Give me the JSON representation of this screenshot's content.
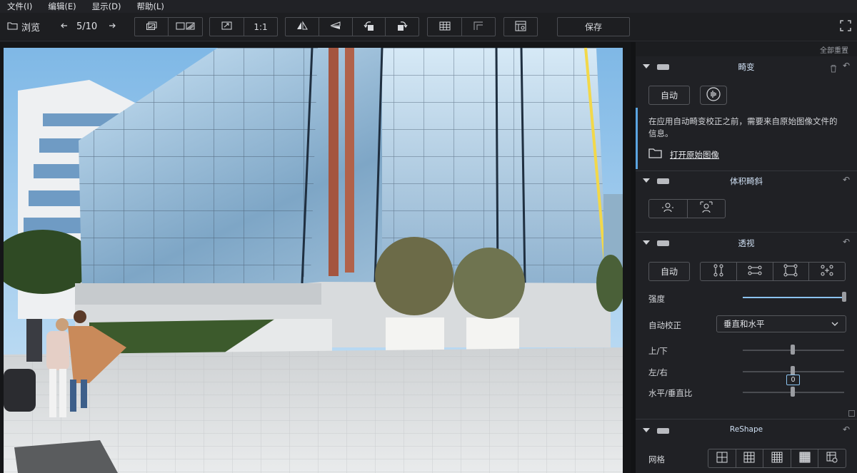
{
  "menu": [
    "文件(I)",
    "编辑(E)",
    "显示(D)",
    "帮助(L)"
  ],
  "toolbar": {
    "browse_label": "浏览",
    "page_counter": "5/10",
    "zoom_1to1": "1:1",
    "save_label": "保存"
  },
  "panel": {
    "top_label": "全部重置",
    "distortion": {
      "title": "畸变",
      "auto_label": "自动",
      "info_text_1": "在应用自动畸变校正之前，需要来自原始图像文件的",
      "info_text_2": "信息。",
      "open_raw_link": "打开原始图像"
    },
    "volume": {
      "title": "体积畸斜"
    },
    "perspective": {
      "title": "透视",
      "auto_label": "自动",
      "strength_label": "强度",
      "strength_value": 1.0,
      "auto_correct_label": "自动校正",
      "auto_correct_value": "垂直和水平",
      "updown_label": "上/下",
      "leftright_label": "左/右",
      "leftright_value": "0",
      "ratio_label": "水平/垂直比"
    },
    "reshape": {
      "title": "ReShape",
      "grid_label": "网格"
    }
  },
  "colors": {
    "accent": "#8cc4f0",
    "panel_bg": "#202125",
    "app_bg": "#1b1c1f"
  }
}
